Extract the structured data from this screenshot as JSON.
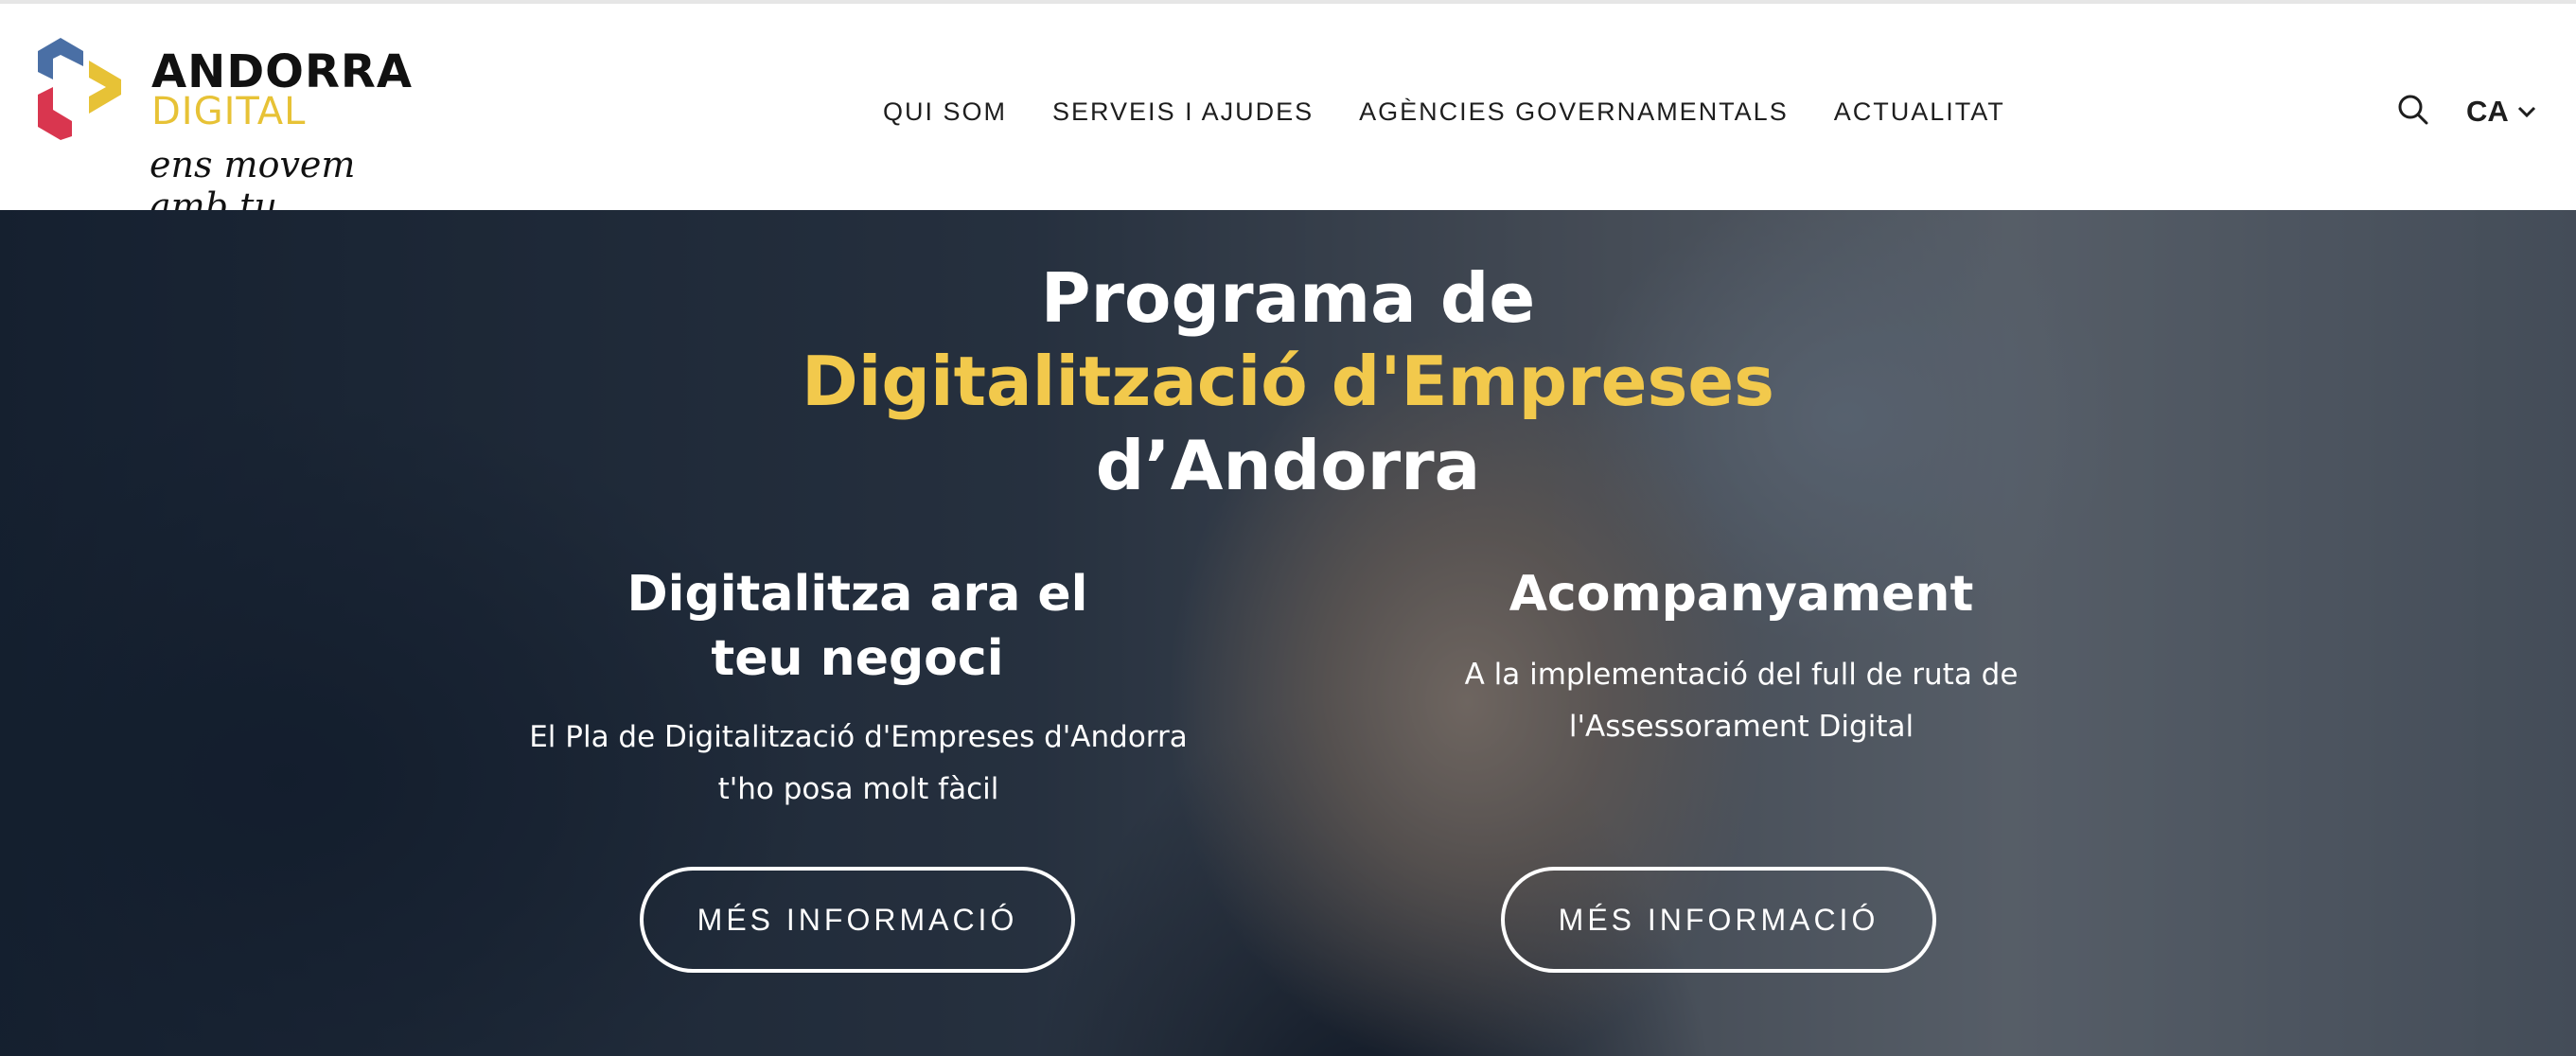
{
  "brand": {
    "name_line1": "ANDORRA",
    "name_line2": "DIGITAL",
    "tagline": "ens movem amb tu",
    "colors": {
      "blue": "#4a6fa5",
      "red": "#d9364f",
      "yellow": "#e7c236"
    }
  },
  "nav": {
    "items": [
      {
        "label": "QUI SOM"
      },
      {
        "label": "SERVEIS I AJUDES"
      },
      {
        "label": "AGÈNCIES GOVERNAMENTALS"
      },
      {
        "label": "ACTUALITAT"
      }
    ]
  },
  "header_tools": {
    "search_icon": "search-icon",
    "language": {
      "label": "CA",
      "icon": "chevron-down-icon"
    }
  },
  "hero": {
    "title_line1": "Programa de",
    "title_line2": "Digitalització d'Empreses",
    "title_line3": "d’Andorra",
    "accent_color": "#f2c94c",
    "columns": [
      {
        "title": "Digitalitza ara el teu negoci",
        "text": "El Pla de Digitalització d'Empreses d'Andorra t'ho posa molt fàcil",
        "button_label": "MÉS INFORMACIÓ"
      },
      {
        "title": "Acompanyament",
        "text": "A la implementació del full de ruta de l'Assessorament Digital",
        "button_label": "MÉS INFORMACIÓ"
      }
    ]
  }
}
